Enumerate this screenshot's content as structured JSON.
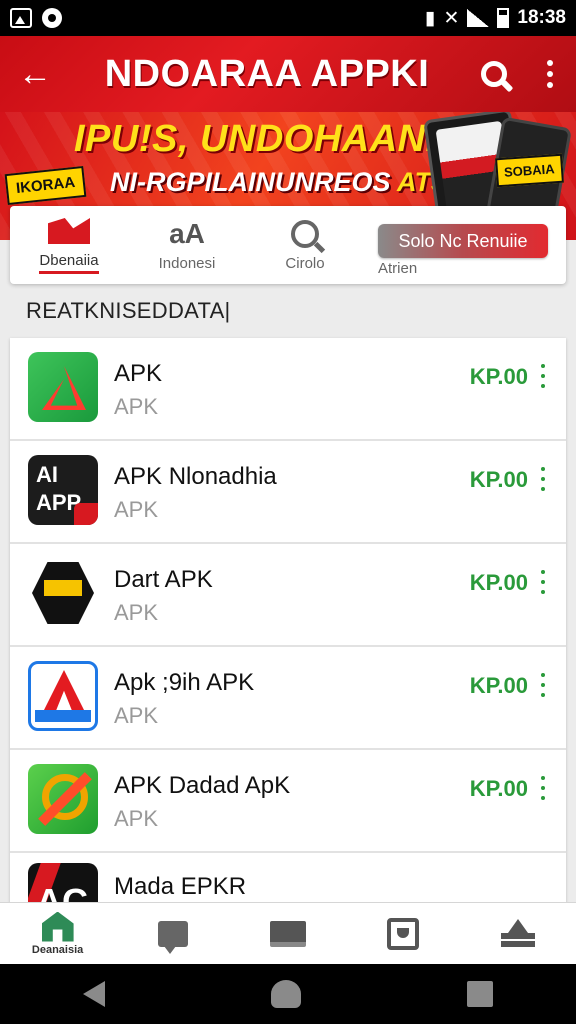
{
  "status_bar": {
    "time": "18:38",
    "icons": [
      "photo-icon",
      "circle-icon",
      "vibrate-icon",
      "mute-icon",
      "wifi-icon",
      "signal-icon",
      "battery-icon"
    ]
  },
  "app_bar": {
    "title": "NDOARAA APPKI",
    "icons": [
      "back-arrow-icon",
      "search-icon",
      "more-vert-icon"
    ]
  },
  "banner": {
    "line1": "IPU!S, UNDOHAANIA",
    "line2_main": "NI-RGPILAINUNREOS ",
    "line2_accent": "ATSY",
    "tag_left": "IKORAA",
    "tag_right": "SOBAIA"
  },
  "categories": {
    "items": [
      {
        "label": "Dbenaiia",
        "icon": "flag-icon",
        "active": true
      },
      {
        "label": "Indonesi",
        "icon": "text-icon",
        "icon_text": "aA",
        "active": false
      },
      {
        "label": "Cirolo",
        "icon": "magnify-icon",
        "active": false
      }
    ],
    "promo_button": "Solo Nc Renuiie",
    "promo_sub": "Atrien"
  },
  "section_title": "REATKNISEDDATA|",
  "apps": [
    {
      "name": "APK",
      "sub": "APK",
      "price": "KP.00"
    },
    {
      "name": "APK Nlonadhia",
      "sub": "APK",
      "price": "KP.00",
      "icon_text": "AI APP"
    },
    {
      "name": "Dart APK",
      "sub": "APK",
      "price": "KP.00"
    },
    {
      "name": "Apk ;9ih APK",
      "sub": "APK",
      "price": "KP.00"
    },
    {
      "name": "APK Dadad ApK",
      "sub": "APK",
      "price": "KP.00"
    },
    {
      "name": "Mada EPKR",
      "icon_text": "AC"
    }
  ],
  "bottom_nav": {
    "items": [
      {
        "label": "Deanaisia",
        "icon": "home-icon"
      },
      {
        "label": "",
        "icon": "chat-icon"
      },
      {
        "label": "",
        "icon": "monitor-icon"
      },
      {
        "label": "",
        "icon": "box-icon"
      },
      {
        "label": "",
        "icon": "upload-icon"
      }
    ]
  },
  "colors": {
    "primary_red": "#e31b21",
    "banner_yellow": "#ffe11a",
    "price_green": "#2a9a3a",
    "nav_green": "#2e8b57"
  }
}
